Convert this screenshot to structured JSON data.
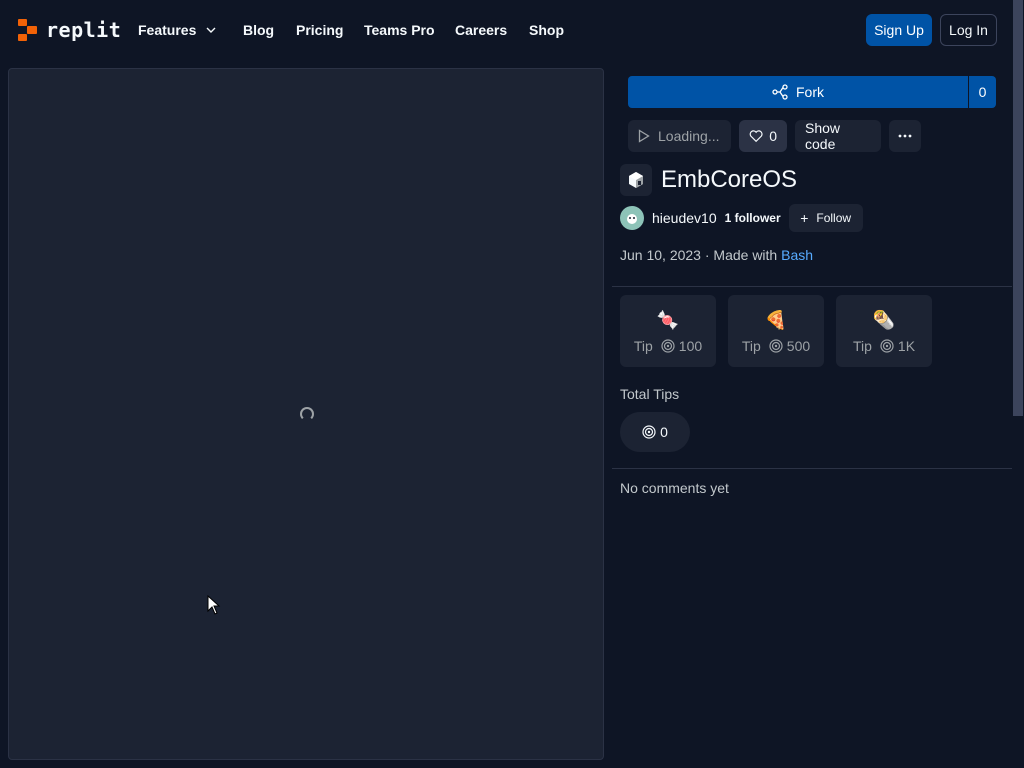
{
  "brand": {
    "name": "replit",
    "logo_color": "#f26207"
  },
  "nav": {
    "features": "Features",
    "blog": "Blog",
    "pricing": "Pricing",
    "teams_pro": "Teams Pro",
    "careers": "Careers",
    "shop": "Shop",
    "sign_up": "Sign Up",
    "log_in": "Log In"
  },
  "repl": {
    "fork_label": "Fork",
    "fork_count": "0",
    "run_label": "Loading...",
    "likes": "0",
    "show_code": "Show code",
    "title": "EmbCoreOS",
    "author": "hieudev10",
    "followers": "1 follower",
    "follow_label": "Follow",
    "date": "Jun 10, 2023",
    "made_with_prefix": "· Made with",
    "language": "Bash"
  },
  "tips": [
    {
      "emoji": "🍬",
      "label": "Tip",
      "amount": "100"
    },
    {
      "emoji": "🍕",
      "label": "Tip",
      "amount": "500"
    },
    {
      "emoji": "🌯",
      "label": "Tip",
      "amount": "1K"
    }
  ],
  "total_tips": {
    "label": "Total Tips",
    "value": "0"
  },
  "comments": {
    "empty_text": "No comments yet"
  },
  "colors": {
    "background": "#0e1525",
    "surface": "#1c2333",
    "primary": "#0053a6",
    "link": "#57abff"
  }
}
